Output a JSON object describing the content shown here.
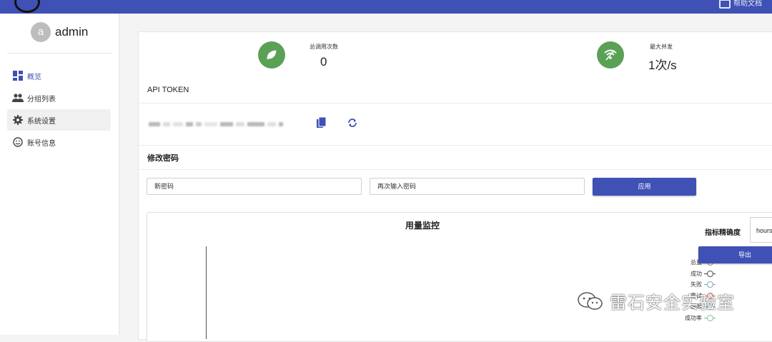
{
  "header": {
    "right_text": "帮助文档"
  },
  "user": {
    "avatar_letter": "a",
    "name": "admin"
  },
  "sidebar": {
    "items": [
      {
        "label": "概览",
        "icon": "dashboard-icon"
      },
      {
        "label": "分组列表",
        "icon": "people-icon"
      },
      {
        "label": "系统设置",
        "icon": "gear-icon"
      },
      {
        "label": "账号信息",
        "icon": "smiley-icon"
      }
    ]
  },
  "stats": {
    "total_calls_label": "总调用次数",
    "total_calls_value": "0",
    "max_concurrency_label": "最大并发",
    "max_concurrency_value": "1次/s"
  },
  "token": {
    "title": "API TOKEN"
  },
  "password": {
    "title": "修改密码",
    "new_placeholder": "新密码",
    "confirm_placeholder": "再次输入密码",
    "apply_label": "应用"
  },
  "chart": {
    "title": "用量监控",
    "precision_label": "指标精确度",
    "precision_value": "hours",
    "export_label": "导出"
  },
  "chart_data": {
    "type": "line",
    "title": "用量监控",
    "series": [
      {
        "name": "总量",
        "color": "#e06666"
      },
      {
        "name": "成功",
        "color": "#444444"
      },
      {
        "name": "失败",
        "color": "#76a5af"
      },
      {
        "name": "重试",
        "color": "#e06666"
      },
      {
        "name": "超限",
        "color": "#6d9eeb"
      },
      {
        "name": "成功率",
        "color": "#7ac29a"
      }
    ],
    "legend_position": "right"
  },
  "watermark": {
    "text": "雷石安全实验室"
  },
  "colors": {
    "primary": "#3f51b5",
    "green": "#5aa155"
  }
}
